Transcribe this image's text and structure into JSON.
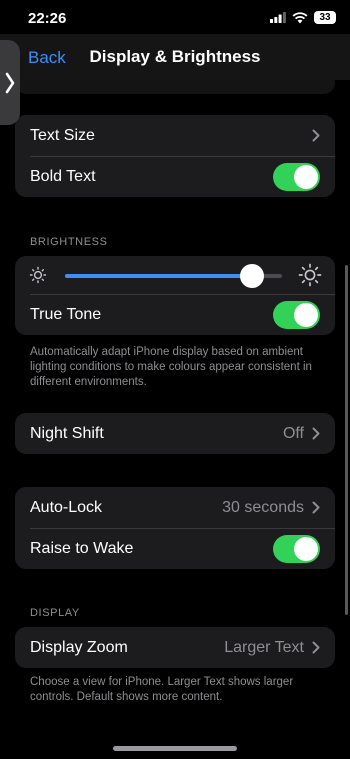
{
  "status": {
    "time": "22:26",
    "battery": "33"
  },
  "nav": {
    "back": "Back",
    "title": "Display & Brightness"
  },
  "text_group": {
    "text_size": "Text Size",
    "bold_text": "Bold Text",
    "bold_text_on": true
  },
  "brightness": {
    "header": "BRIGHTNESS",
    "level": 0.86,
    "true_tone": "True Tone",
    "true_tone_on": true,
    "footer": "Automatically adapt iPhone display based on ambient lighting conditions to make colours appear consistent in different environments."
  },
  "night_shift": {
    "label": "Night Shift",
    "value": "Off"
  },
  "lock": {
    "auto_lock": "Auto-Lock",
    "auto_lock_value": "30 seconds",
    "raise_to_wake": "Raise to Wake",
    "raise_to_wake_on": true
  },
  "display": {
    "header": "DISPLAY",
    "zoom": "Display Zoom",
    "zoom_value": "Larger Text",
    "footer": "Choose a view for iPhone. Larger Text shows larger controls. Default shows more content."
  },
  "icons": {
    "chevron": "chevron-right-icon",
    "sun_small": "sun-small-icon",
    "sun_large": "sun-large-icon",
    "side_handle": "chevron-right-icon"
  },
  "colors": {
    "accent": "#3d8ef7",
    "toggle_on": "#32d158",
    "background": "#000000",
    "cell": "#1c1c1e",
    "secondary_text": "#8e8e93"
  }
}
